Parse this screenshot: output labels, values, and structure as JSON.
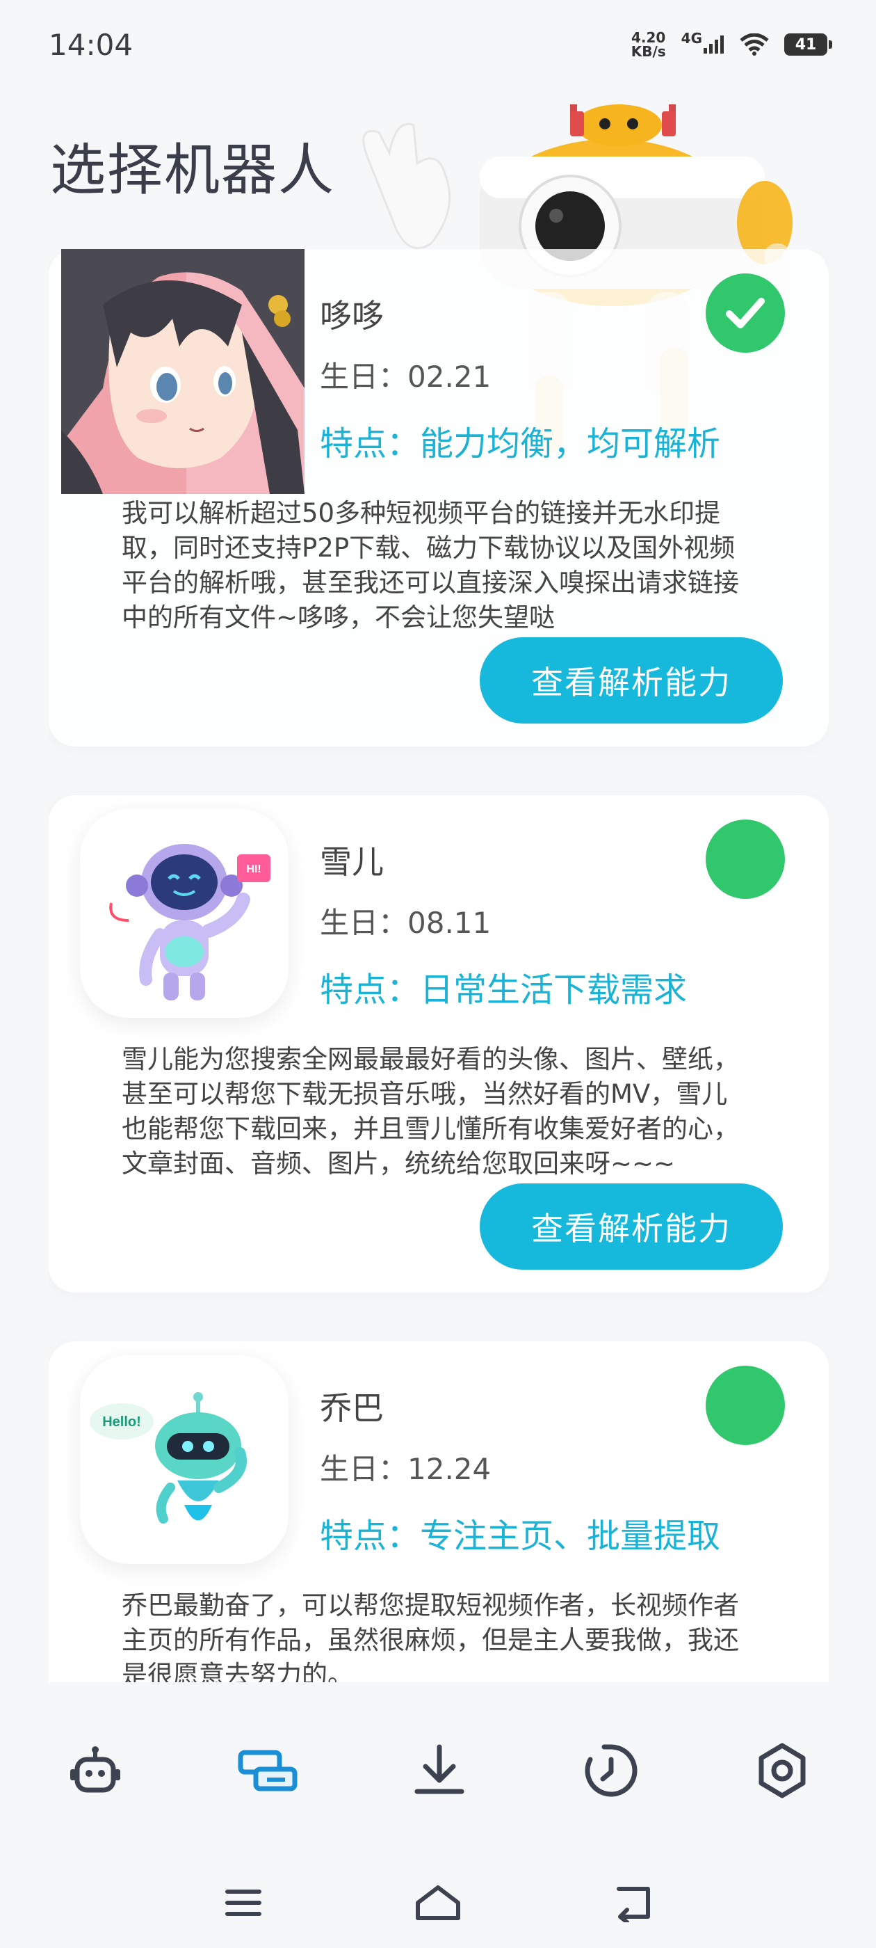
{
  "status": {
    "time": "14:04",
    "net_speed_value": "4.20",
    "net_speed_unit": "KB/s",
    "network": "4G",
    "battery": "41"
  },
  "page_title": "选择机器人",
  "robots": [
    {
      "name": "哆哆",
      "birthday": "生日：02.21",
      "feature": "特点：能力均衡，均可解析",
      "description": "我可以解析超过50多种短视频平台的链接并无水印提取，同时还支持P2P下载、磁力下载协议以及国外视频平台的解析哦，甚至我还可以直接深入嗅探出请求链接中的所有文件~哆哆，不会让您失望哒",
      "button": "查看解析能力",
      "selected": true
    },
    {
      "name": "雪儿",
      "birthday": "生日：08.11",
      "feature": "特点：日常生活下载需求",
      "description": "雪儿能为您搜索全网最最最好看的头像、图片、壁纸，甚至可以帮您下载无损音乐哦，当然好看的MV，雪儿也能帮您下载回来，并且雪儿懂所有收集爱好者的心，文章封面、音频、图片，统统给您取回来呀~~~",
      "button": "查看解析能力",
      "selected": false,
      "avatar_badge": "HI!"
    },
    {
      "name": "乔巴",
      "birthday": "生日：12.24",
      "feature": "特点：专注主页、批量提取",
      "description": "乔巴最勤奋了，可以帮您提取短视频作者，长视频作者主页的所有作品，虽然很麻烦，但是主人要我做，我还是很愿意去努力的。",
      "selected": false,
      "avatar_badge": "Hello!"
    }
  ],
  "tabs": [
    {
      "icon": "robot-icon",
      "active": false
    },
    {
      "icon": "parse-link-icon",
      "active": true
    },
    {
      "icon": "download-icon",
      "active": false
    },
    {
      "icon": "history-icon",
      "active": false
    },
    {
      "icon": "settings-icon",
      "active": false
    }
  ],
  "nav": [
    "menu-icon",
    "home-icon",
    "back-icon"
  ],
  "colors": {
    "accent": "#16b9dc",
    "selected_green": "#31c86d",
    "title": "#3a3d4a",
    "tab_active": "#1a8fd6"
  }
}
